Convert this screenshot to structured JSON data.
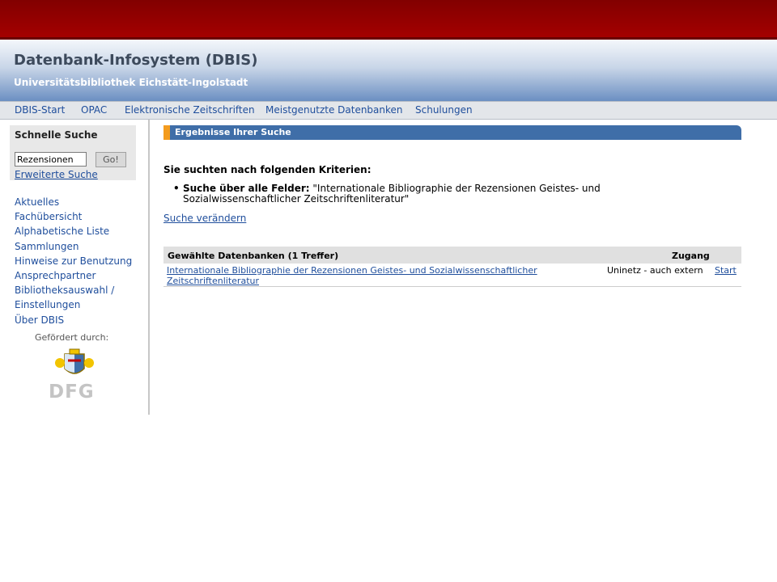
{
  "header": {
    "title": "Datenbank-Infosystem (DBIS)",
    "subtitle": "Universitätsbibliothek Eichstätt-Ingolstadt"
  },
  "nav": [
    "DBIS-Start",
    "OPAC",
    "Elektronische Zeitschriften",
    "Meistgenutzte Datenbanken",
    "Schulungen"
  ],
  "quick_search": {
    "title": "Schnelle Suche",
    "value": "Rezensionen",
    "button": "Go!",
    "advanced": "Erweiterte Suche"
  },
  "sidebar_links": [
    "Aktuelles",
    "Fachübersicht",
    "Alphabetische Liste",
    "Sammlungen",
    "Hinweise zur Benutzung",
    "Ansprechpartner",
    "Bibliotheksauswahl /",
    "Einstellungen",
    "Über DBIS"
  ],
  "promotion": {
    "label": "Gefördert durch:",
    "dfg": "DFG"
  },
  "results": {
    "heading": "Ergebnisse Ihrer Suche",
    "criteria_title": "Sie suchten nach folgenden Kriterien:",
    "criteria_field": "Suche über alle Felder:",
    "criteria_value": "\"Internationale Bibliographie der Rezensionen Geistes- und Sozialwissenschaftlicher Zeitschriftenliteratur\"",
    "change_search": "Suche verändern",
    "table_header": "Gewählte Datenbanken (1 Treffer)",
    "access_header": "Zugang",
    "rows": [
      {
        "title": "Internationale Bibliographie der Rezensionen Geistes- und Sozialwissenschaftlicher Zeitschriftenliteratur",
        "access": "Uninetz - auch extern",
        "start": "Start"
      }
    ]
  }
}
